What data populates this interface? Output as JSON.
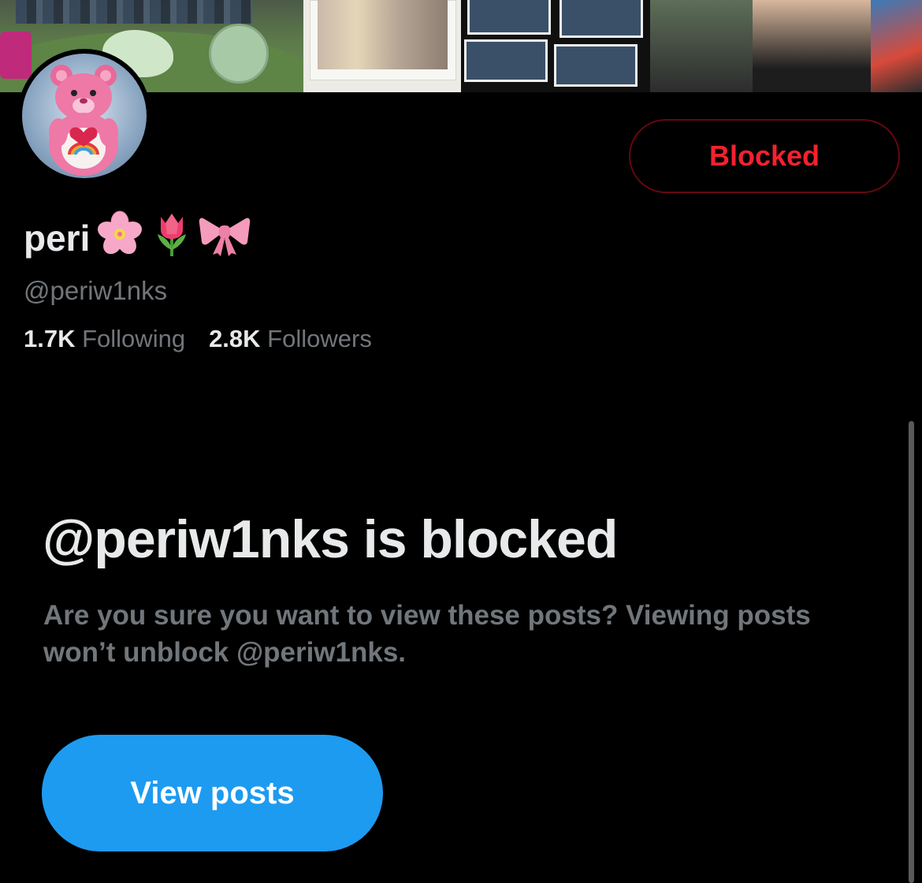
{
  "banner": {
    "description_icon": "header-photo-collage"
  },
  "profile": {
    "display_name": "peri",
    "name_emojis": [
      "cherry-blossom-icon",
      "tulip-icon",
      "ribbon-icon"
    ],
    "handle": "@periw1nks",
    "following_count": "1.7K",
    "following_label": "Following",
    "followers_count": "2.8K",
    "followers_label": "Followers"
  },
  "actions": {
    "blocked_label": "Blocked"
  },
  "notice": {
    "title": "@periw1nks is blocked",
    "description": "Are you sure you want to view these posts? Viewing posts won’t unblock @periw1nks.",
    "view_posts_label": "View posts"
  },
  "colors": {
    "background": "#000000",
    "primary_text": "#e7e9ea",
    "secondary_text": "#71767b",
    "blocked_red": "#f4212e",
    "blocked_border": "#67070f",
    "accent_blue": "#1d9bf0"
  }
}
